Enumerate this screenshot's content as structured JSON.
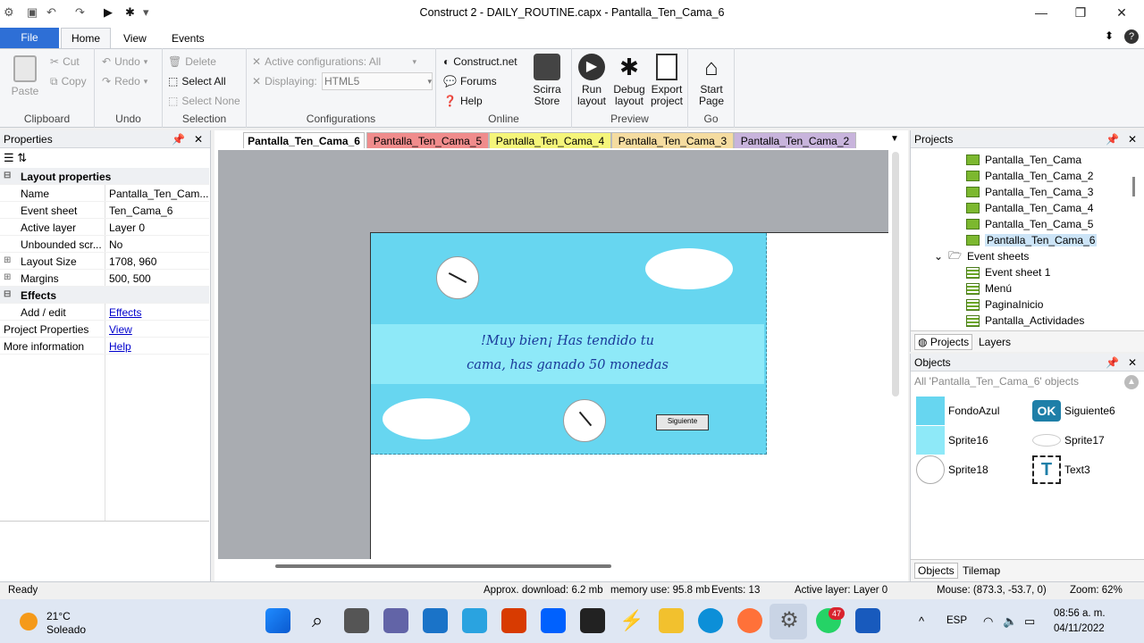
{
  "window": {
    "title": "Construct 2 - DAILY_ROUTINE.capx - Pantalla_Ten_Cama_6",
    "minimize": "—",
    "restore": "❐",
    "close": "✕"
  },
  "ribbon_tabs": {
    "file": "File",
    "home": "Home",
    "view": "View",
    "events": "Events"
  },
  "ribbon": {
    "clipboard": {
      "label": "Clipboard",
      "paste": "Paste",
      "cut": "Cut",
      "copy": "Copy"
    },
    "undo": {
      "label": "Undo",
      "undo": "Undo",
      "redo": "Redo"
    },
    "selection": {
      "label": "Selection",
      "delete": "Delete",
      "select_all": "Select All",
      "select_none": "Select None"
    },
    "configurations": {
      "label": "Configurations",
      "active": "Active configurations: All",
      "displaying": "Displaying:",
      "displaying_value": "HTML5"
    },
    "online": {
      "label": "Online",
      "construct_net": "Construct.net",
      "forums": "Forums",
      "help": "Help",
      "scirra_store_1": "Scirra",
      "scirra_store_2": "Store"
    },
    "preview": {
      "label": "Preview",
      "run_1": "Run",
      "run_2": "layout",
      "debug_1": "Debug",
      "debug_2": "layout",
      "export_1": "Export",
      "export_2": "project"
    },
    "go": {
      "label": "Go",
      "start_1": "Start",
      "start_2": "Page"
    }
  },
  "properties": {
    "title": "Properties",
    "rows": [
      {
        "key": "Layout properties",
        "value": ""
      },
      {
        "key": "Name",
        "value": "Pantalla_Ten_Cam..."
      },
      {
        "key": "Event sheet",
        "value": "Ten_Cama_6"
      },
      {
        "key": "Active layer",
        "value": "Layer 0"
      },
      {
        "key": "Unbounded scr...",
        "value": "No"
      },
      {
        "key": "Layout Size",
        "value": "1708, 960"
      },
      {
        "key": "Margins",
        "value": "500, 500"
      },
      {
        "key": "Effects",
        "value": ""
      },
      {
        "key": "Add / edit",
        "value": "Effects"
      },
      {
        "key": "Project Properties",
        "value": "View"
      },
      {
        "key": "More information",
        "value": "Help"
      }
    ]
  },
  "doc_tabs": [
    "Pantalla_Ten_Cama_6",
    "Pantalla_Ten_Cama_5",
    "Pantalla_Ten_Cama_4",
    "Pantalla_Ten_Cama_3",
    "Pantalla_Ten_Cama_2"
  ],
  "doc_tab_colors": [
    "#f0f0f0",
    "#f08c8c",
    "#f5f57a",
    "#f5dca0",
    "#c8b4dc"
  ],
  "layout_view": {
    "message_line1": "!Muy bien¡ Has tendido tu",
    "message_line2": "cama, has ganado 50 monedas",
    "button": "Siguiente"
  },
  "projects": {
    "title": "Projects",
    "layouts": [
      "Pantalla_Ten_Cama",
      "Pantalla_Ten_Cama_2",
      "Pantalla_Ten_Cama_3",
      "Pantalla_Ten_Cama_4",
      "Pantalla_Ten_Cama_5",
      "Pantalla_Ten_Cama_6"
    ],
    "event_sheets_folder": "Event sheets",
    "event_sheets": [
      "Event sheet 1",
      "Menú",
      "PaginaInicio",
      "Pantalla_Actividades"
    ],
    "tabs": {
      "projects": "Projects",
      "layers": "Layers"
    }
  },
  "objects": {
    "title": "Objects",
    "filter": "All 'Pantalla_Ten_Cama_6' objects",
    "items": [
      "FondoAzul",
      "Siguiente6",
      "Sprite16",
      "Sprite17",
      "Sprite18",
      "Text3"
    ],
    "ok_label": "OK",
    "text_icon": "T",
    "tabs": {
      "objects": "Objects",
      "tilemap": "Tilemap"
    }
  },
  "status": {
    "ready": "Ready",
    "download": "Approx. download: 6.2 mb",
    "memory": "memory use: 95.8 mb",
    "events": "Events: 13",
    "active_layer": "Active layer: Layer 0",
    "mouse": "Mouse: (873.3, -53.7, 0)",
    "zoom": "Zoom: 62%"
  },
  "taskbar": {
    "temp": "21°C",
    "weather": "Soleado",
    "lang": "ESP",
    "time": "08:56 a. m.",
    "date": "04/11/2022",
    "whatsapp_badge": "47"
  }
}
